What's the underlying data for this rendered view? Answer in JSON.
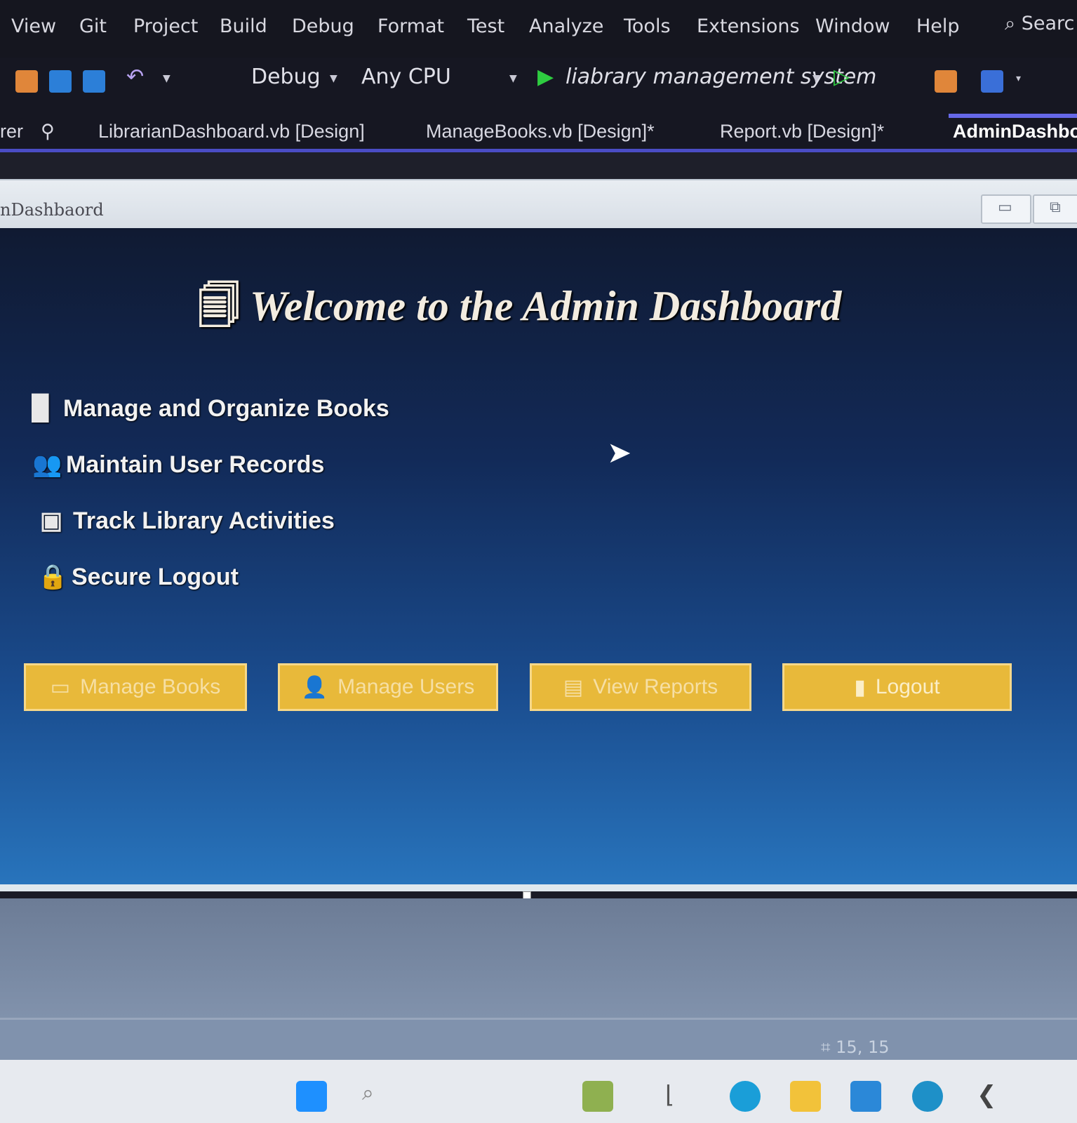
{
  "menubar": {
    "items": [
      "View",
      "Git",
      "Project",
      "Build",
      "Debug",
      "Format",
      "Test",
      "Analyze",
      "Tools",
      "Extensions",
      "Window",
      "Help"
    ],
    "search_label": "Searc"
  },
  "toolbar": {
    "configuration": "Debug",
    "platform": "Any CPU",
    "startup_project": "liabrary management system"
  },
  "tabs": {
    "pinned_fragment": "rer",
    "items": [
      {
        "label": "LibrarianDashboard.vb [Design]"
      },
      {
        "label": "ManageBooks.vb [Design]*"
      },
      {
        "label": "Report.vb [Design]*"
      },
      {
        "label": "AdminDashbo"
      }
    ]
  },
  "form": {
    "title": "nDashbaord",
    "welcome": "Welcome to the Admin Dashboard",
    "features": [
      {
        "label": "Manage and Organize Books"
      },
      {
        "label": "Maintain User Records"
      },
      {
        "label": "Track Library Activities"
      },
      {
        "label": "Secure Logout"
      }
    ],
    "buttons": [
      {
        "label": "Manage Books"
      },
      {
        "label": "Manage Users"
      },
      {
        "label": "View Reports"
      },
      {
        "label": "Logout"
      }
    ]
  },
  "status": {
    "position": "15, 15"
  },
  "colors": {
    "button_bg": "#e8b93a",
    "form_gradient_top": "#101a32",
    "form_gradient_bottom": "#2874bc",
    "tab_underline": "#4a4cc4"
  }
}
